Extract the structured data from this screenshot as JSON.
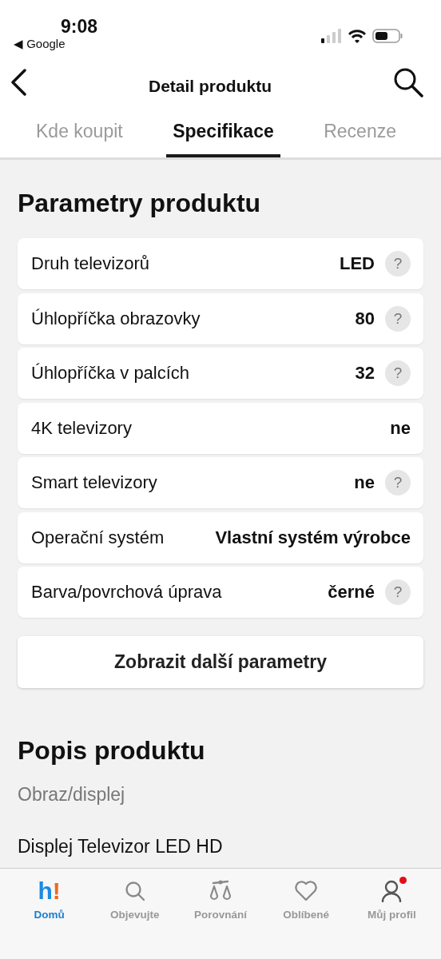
{
  "status_bar": {
    "time": "9:08",
    "back_app": "◀ Google"
  },
  "header": {
    "title": "Detail produktu"
  },
  "tabs": [
    {
      "label": "Kde koupit",
      "selected": false
    },
    {
      "label": "Specifikace",
      "selected": true
    },
    {
      "label": "Recenze",
      "selected": false
    }
  ],
  "parameters": {
    "title": "Parametry produktu",
    "rows": [
      {
        "name": "Druh televizorů",
        "value": "LED",
        "help": "?"
      },
      {
        "name": "Úhlopříčka obrazovky",
        "value": "80",
        "help": "?"
      },
      {
        "name": "Úhlopříčka v palcích",
        "value": "32",
        "help": "?"
      },
      {
        "name": "4K televizory",
        "value": "ne"
      },
      {
        "name": "Smart televizory",
        "value": "ne",
        "help": "?"
      },
      {
        "name": "Operační systém",
        "value": "Vlastní systém výrobce"
      },
      {
        "name": "Barva/povrchová úprava",
        "value": "černé",
        "help": "?"
      }
    ],
    "more_button": "Zobrazit další parametry"
  },
  "description": {
    "title": "Popis produktu",
    "subtitle": "Obraz/displej",
    "text": "Displej Televizor LED HD"
  },
  "bottom_nav": [
    {
      "kind": "logo",
      "logo": [
        "h",
        "!"
      ],
      "label": "Domů",
      "selected": true,
      "badge": false
    },
    {
      "kind": "search",
      "label": "Objevujte",
      "selected": false,
      "badge": false
    },
    {
      "kind": "compare",
      "label": "Porovnání",
      "selected": false,
      "badge": false
    },
    {
      "kind": "heart",
      "label": "Oblíbené",
      "selected": false,
      "badge": false
    },
    {
      "kind": "profile",
      "label": "Můj profil",
      "selected": false,
      "badge": true
    }
  ]
}
